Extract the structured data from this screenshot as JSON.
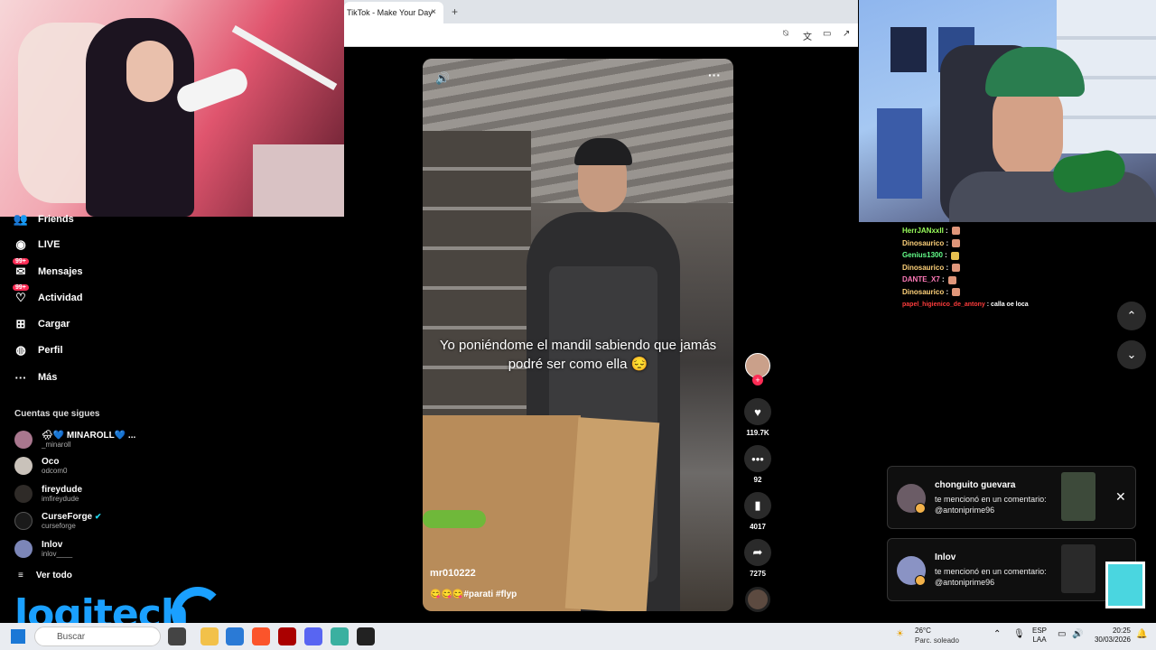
{
  "browser": {
    "tab_title": "TikTok - Make Your Day",
    "tab_close": "×",
    "new_tab": "+"
  },
  "sidebar": {
    "items": [
      {
        "label": "Friends",
        "icon": "friends-icon"
      },
      {
        "label": "LIVE",
        "icon": "live-icon"
      },
      {
        "label": "Mensajes",
        "icon": "messages-icon",
        "badge": "99+"
      },
      {
        "label": "Actividad",
        "icon": "activity-icon",
        "badge": "99+"
      },
      {
        "label": "Cargar",
        "icon": "upload-icon"
      },
      {
        "label": "Perfil",
        "icon": "profile-icon"
      },
      {
        "label": "Más",
        "icon": "more-icon"
      }
    ],
    "following_title": "Cuentas que sigues",
    "following": [
      {
        "name": "🌧💙 MINAROLL💙 ...",
        "user": "_minaroll",
        "verified": false
      },
      {
        "name": "Oco",
        "user": "odcom0",
        "verified": false
      },
      {
        "name": "fireydude",
        "user": "imfireydude",
        "verified": false
      },
      {
        "name": "CurseForge",
        "user": "curseforge",
        "verified": true
      },
      {
        "name": "Inlov",
        "user": "inlov____",
        "verified": false
      }
    ],
    "see_all": "Ver todo",
    "see_all_icon": "≡"
  },
  "overlay": {
    "brand": "logitech"
  },
  "video": {
    "caption": "Yo poniéndome el mandil sabiendo que jamás podré ser como ella 😔",
    "username": "mr010222",
    "description": "😋😋😋#parati #flyp",
    "volume_icon": "🔊",
    "more_icon": "···"
  },
  "actions": {
    "likes": "119.7K",
    "comments": "92",
    "saves": "4017",
    "shares": "7275"
  },
  "chat": [
    {
      "user": "HerrJANxxII",
      "color": "#9aff5c",
      "msg": ""
    },
    {
      "user": "Dinosaurico",
      "color": "#ffd27a",
      "msg": ""
    },
    {
      "user": "Genius1300",
      "color": "#64ff8a",
      "msg": ""
    },
    {
      "user": "Dinosaurico",
      "color": "#ffd27a",
      "msg": ""
    },
    {
      "user": "DANTE_X7",
      "color": "#ff7ab8",
      "msg": ""
    },
    {
      "user": "Dinosaurico",
      "color": "#ffd27a",
      "msg": ""
    },
    {
      "user": "papel_higienico_de_antony",
      "color": "#ff3c3c",
      "msg": "calla oe loca"
    }
  ],
  "notifications": [
    {
      "name": "chonguito guevara",
      "text": "te mencionó en un comentario: @antoniprime96",
      "close": "✕"
    },
    {
      "name": "Inlov",
      "text": "te mencionó en un comentario: @antoniprime96"
    }
  ],
  "taskbar": {
    "search_placeholder": "Buscar",
    "weather_temp": "26°C",
    "weather_desc": "Parc. soleado",
    "lang_1": "ESP",
    "lang_2": "LAA",
    "time": "20:25",
    "date": "30/03/2026"
  }
}
